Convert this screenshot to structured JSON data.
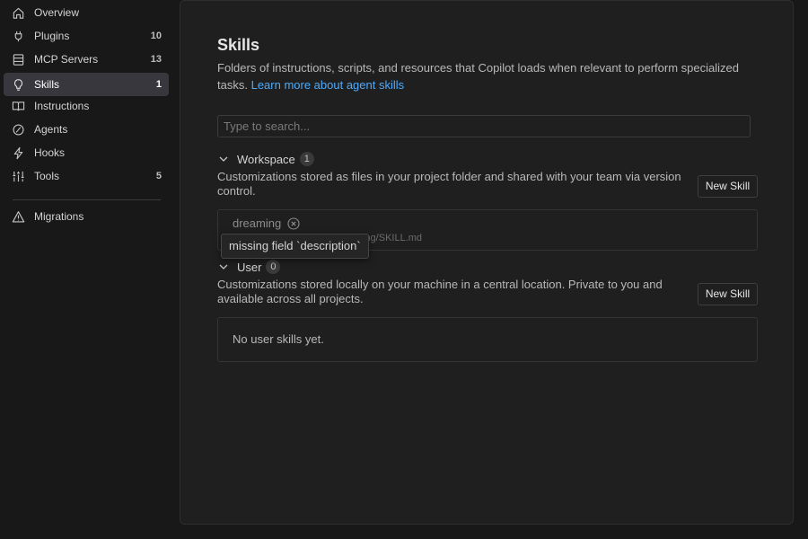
{
  "sidebar": {
    "items": [
      {
        "label": "Overview",
        "count": "",
        "icon": "home-icon"
      },
      {
        "label": "Plugins",
        "count": "10",
        "icon": "plug-icon"
      },
      {
        "label": "MCP Servers",
        "count": "13",
        "icon": "server-icon"
      },
      {
        "label": "Skills",
        "count": "1",
        "icon": "lightbulb-icon",
        "active": true
      },
      {
        "label": "Instructions",
        "count": "",
        "icon": "book-icon"
      },
      {
        "label": "Agents",
        "count": "",
        "icon": "agent-icon"
      },
      {
        "label": "Hooks",
        "count": "",
        "icon": "bolt-icon"
      },
      {
        "label": "Tools",
        "count": "5",
        "icon": "tools-icon"
      },
      {
        "label": "Migrations",
        "count": "",
        "icon": "warning-icon"
      }
    ]
  },
  "main": {
    "title": "Skills",
    "description": "Folders of instructions, scripts, and resources that Copilot loads when relevant to perform specialized tasks.",
    "learn_more": "Learn more about agent skills",
    "search_placeholder": "Type to search...",
    "workspace": {
      "label": "Workspace",
      "count": "1",
      "description": "Customizations stored as files in your project folder and shared with your team via version control.",
      "button": "New Skill",
      "skill": {
        "name": "dreaming",
        "path": "ing/SKILL.md",
        "error": "missing field `description`"
      }
    },
    "user": {
      "label": "User",
      "count": "0",
      "description": "Customizations stored locally on your machine in a central location. Private to you and available across all projects.",
      "button": "New Skill",
      "empty": "No user skills yet."
    }
  },
  "colors": {
    "background": "#181818",
    "panel": "#1f1f1f",
    "active_item": "#37373d",
    "link": "#4daafc",
    "text": "#cccccc"
  }
}
